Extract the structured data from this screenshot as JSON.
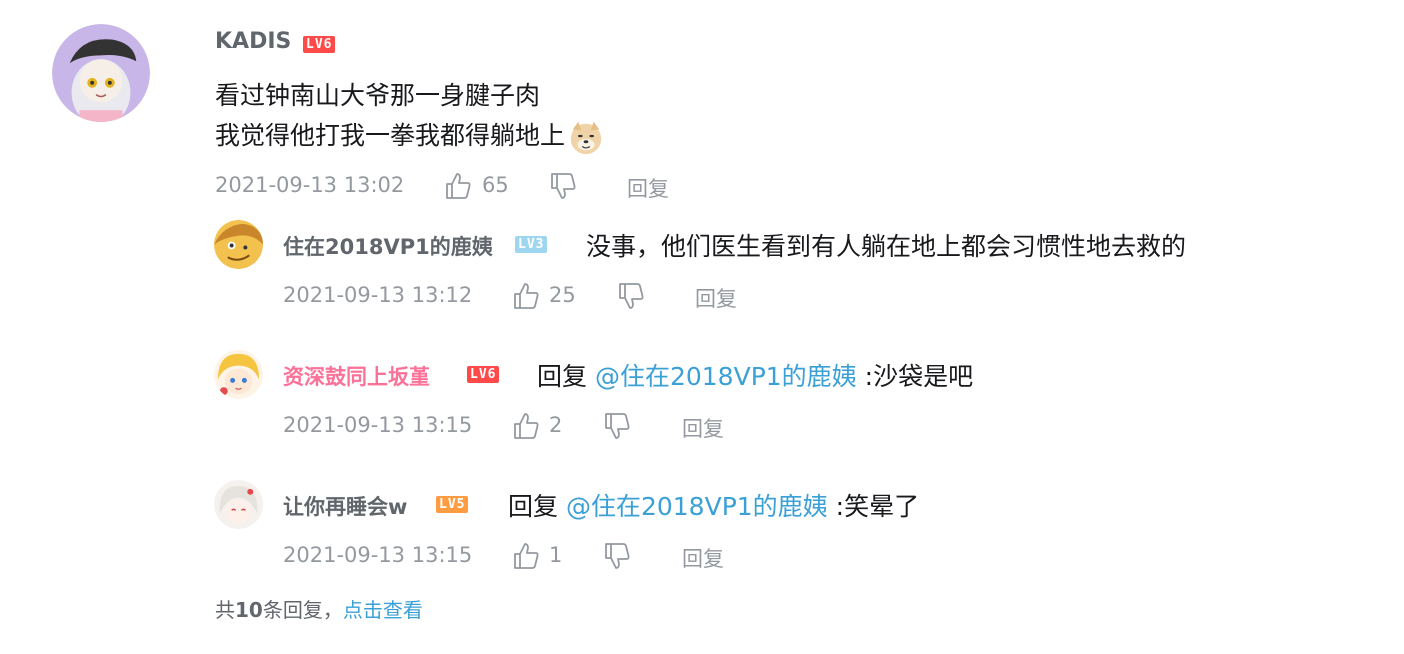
{
  "comment": {
    "user": "KADIS",
    "level": "LV6",
    "lines": [
      "看过钟南山大爷那一身腱子肉",
      "我觉得他打我一拳我都得躺地上"
    ],
    "emoji": "doge-emoji",
    "time": "2021-09-13 13:02",
    "likes": "65",
    "reply_label": "回复"
  },
  "replies": [
    {
      "user": "住在2018VP1的鹿姨",
      "level": "LV3",
      "prefix": "",
      "mention": "",
      "text": "没事，他们医生看到有人躺在地上都会习惯性地去救的",
      "time": "2021-09-13 13:12",
      "likes": "25",
      "reply_label": "回复"
    },
    {
      "user": "资深鼓同上坂堇",
      "level": "LV6",
      "prefix": "回复",
      "mention": "@住在2018VP1的鹿姨",
      "text": ":沙袋是吧",
      "time": "2021-09-13 13:15",
      "likes": "2",
      "reply_label": "回复"
    },
    {
      "user": "让你再睡会w",
      "level": "LV5",
      "prefix": "回复",
      "mention": "@住在2018VP1的鹿姨",
      "text": ":笑晕了",
      "time": "2021-09-13 13:15",
      "likes": "1",
      "reply_label": "回复"
    }
  ],
  "footer": {
    "prefix": "共",
    "count": "10",
    "suffix": "条回复，",
    "link": "点击查看"
  },
  "colors": {
    "username": "#61666d",
    "vip_name": "#fb7299",
    "mention": "#3ba0d6",
    "meta": "#9499a0",
    "lv6": "#ff4a4a",
    "lv5": "#ff9c42",
    "lv3": "#9fd6ef"
  }
}
